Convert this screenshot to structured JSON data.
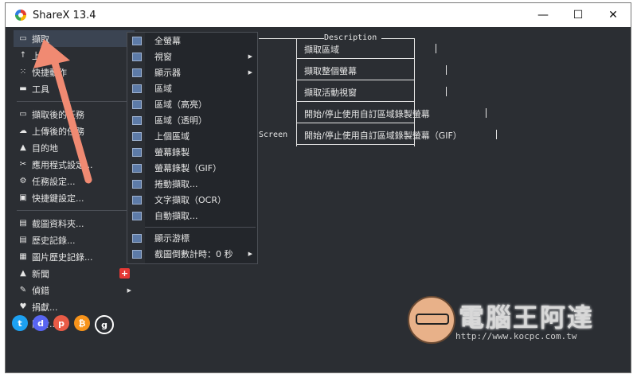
{
  "titlebar": {
    "title": "ShareX 13.4",
    "minimize": "—",
    "maximize": "☐",
    "close": "✕"
  },
  "sidebar": {
    "items": [
      {
        "label": "擷取",
        "icon": "capture-icon",
        "glyph": "▭",
        "arrow": true
      },
      {
        "label": "上傳",
        "icon": "upload-icon",
        "glyph": "↑",
        "arrow": true
      },
      {
        "label": "快捷動作",
        "icon": "workflow-icon",
        "glyph": "⁙",
        "arrow": true
      },
      {
        "label": "工具",
        "icon": "tools-icon",
        "glyph": "▬",
        "arrow": true
      },
      {
        "label": "擷取後的任務",
        "icon": "after-capture-icon",
        "glyph": "▭",
        "arrow": true
      },
      {
        "label": "上傳後的任務",
        "icon": "after-upload-icon",
        "glyph": "☁",
        "arrow": true
      },
      {
        "label": "目的地",
        "icon": "destinations-icon",
        "glyph": "▲",
        "arrow": true
      },
      {
        "label": "應用程式設定...",
        "icon": "app-settings-icon",
        "glyph": "✂",
        "arrow": false
      },
      {
        "label": "任務設定...",
        "icon": "task-settings-icon",
        "glyph": "⚙",
        "arrow": false
      },
      {
        "label": "快捷鍵設定...",
        "icon": "hotkey-settings-icon",
        "glyph": "▣",
        "arrow": false
      }
    ],
    "items2": [
      {
        "label": "截圖資料夾...",
        "icon": "screenshots-folder-icon",
        "glyph": "▤"
      },
      {
        "label": "歷史記錄...",
        "icon": "history-icon",
        "glyph": "▤"
      },
      {
        "label": "圖片歷史記錄...",
        "icon": "image-history-icon",
        "glyph": "▦"
      },
      {
        "label": "新聞",
        "icon": "news-icon",
        "glyph": "▲"
      },
      {
        "label": "偵錯",
        "icon": "debug-icon",
        "glyph": "✎"
      },
      {
        "label": "捐獻...",
        "icon": "donate-icon",
        "glyph": "♥"
      },
      {
        "label": "關於...",
        "icon": "about-icon",
        "glyph": "♛"
      }
    ],
    "news_badge": "+"
  },
  "submenu": {
    "items": [
      {
        "label": "全螢幕",
        "icon": "fullscreen-icon",
        "arrow": false
      },
      {
        "label": "視窗",
        "icon": "window-icon",
        "arrow": true
      },
      {
        "label": "顯示器",
        "icon": "monitor-icon",
        "arrow": true
      },
      {
        "label": "區域",
        "icon": "region-icon",
        "arrow": false
      },
      {
        "label": "區域（高亮）",
        "icon": "region-light-icon",
        "arrow": false
      },
      {
        "label": "區域（透明）",
        "icon": "region-transparent-icon",
        "arrow": false
      },
      {
        "label": "上個區域",
        "icon": "last-region-icon",
        "arrow": false
      },
      {
        "label": "螢幕錄製",
        "icon": "screen-recording-icon",
        "arrow": false
      },
      {
        "label": "螢幕錄製（GIF）",
        "icon": "screen-recording-gif-icon",
        "arrow": false
      },
      {
        "label": "捲動擷取...",
        "icon": "scrolling-capture-icon",
        "arrow": false
      },
      {
        "label": "文字擷取（OCR）",
        "icon": "ocr-icon",
        "arrow": false
      },
      {
        "label": "自動擷取...",
        "icon": "auto-capture-icon",
        "arrow": false
      }
    ],
    "items2": [
      {
        "label": "顯示游標",
        "icon": "cursor-icon",
        "arrow": false
      },
      {
        "label": "截圖倒數計時：0 秒",
        "icon": "timer-icon",
        "arrow": true
      }
    ]
  },
  "main": {
    "header": "Description",
    "rows": [
      {
        "hotkey": "",
        "description": "擷取區域"
      },
      {
        "hotkey": "",
        "description": "擷取整個螢幕"
      },
      {
        "hotkey": "",
        "description": "擷取活動視窗"
      },
      {
        "hotkey": "",
        "description": "開始/停止使用自訂區域錄製螢幕"
      },
      {
        "hotkey": "Screen",
        "description": "開始/停止使用自訂區域錄製螢幕（GIF）"
      }
    ]
  },
  "social": [
    {
      "icon": "twitter-icon",
      "glyph": "t",
      "color": "#1da1f2"
    },
    {
      "icon": "discord-icon",
      "glyph": "d",
      "color": "#5865f2"
    },
    {
      "icon": "patreon-icon",
      "glyph": "p",
      "color": "#e85b46"
    },
    {
      "icon": "bitcoin-icon",
      "glyph": "₿",
      "color": "#f7931a"
    },
    {
      "icon": "github-icon",
      "glyph": "g",
      "color": "#2b2e33"
    }
  ],
  "watermark": {
    "title": "電腦王阿達",
    "url": "http://www.kocpc.com.tw"
  },
  "colors": {
    "accent_arrow": "#f08a72",
    "background": "#2b2e33",
    "text": "#e6e6e6"
  }
}
